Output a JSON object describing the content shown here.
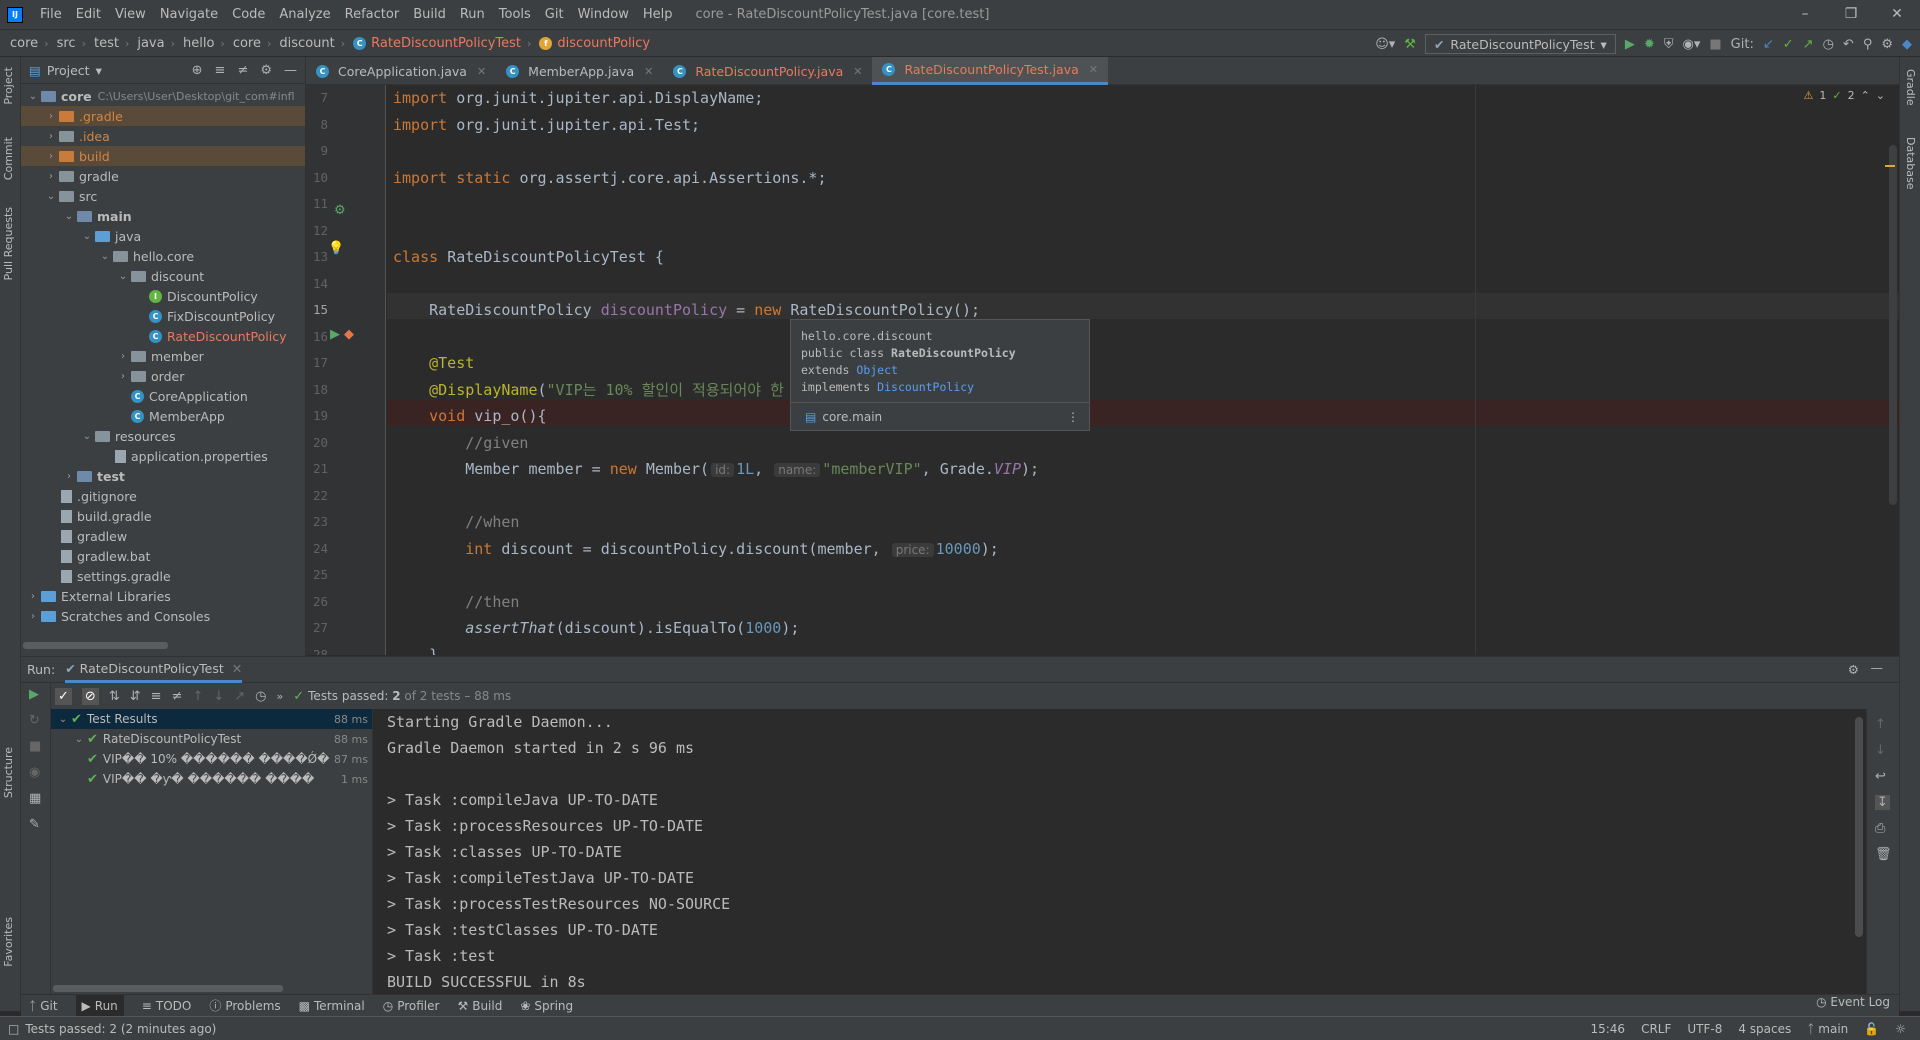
{
  "menu": {
    "items": [
      "File",
      "Edit",
      "View",
      "Navigate",
      "Code",
      "Analyze",
      "Refactor",
      "Build",
      "Run",
      "Tools",
      "Git",
      "Window",
      "Help"
    ],
    "title": "core - RateDiscountPolicyTest.java [core.test]"
  },
  "breadcrumbs": [
    "core",
    "src",
    "test",
    "java",
    "hello",
    "core",
    "discount",
    "RateDiscountPolicyTest",
    "discountPolicy"
  ],
  "toolbar": {
    "run_config": "RateDiscountPolicyTest",
    "git_label": "Git:"
  },
  "project": {
    "title": "Project",
    "root_path": "C:\\Users\\User\\Desktop\\git_com#infl",
    "tree": [
      {
        "label": "core",
        "depth": 0,
        "arrow": "v",
        "type": "src",
        "bold": true
      },
      {
        "label": ".gradle",
        "depth": 1,
        "arrow": ">",
        "type": "orange",
        "color": "orange"
      },
      {
        "label": ".idea",
        "depth": 1,
        "arrow": ">",
        "type": "folder",
        "color": "orange"
      },
      {
        "label": "build",
        "depth": 1,
        "arrow": ">",
        "type": "orange",
        "color": "orange"
      },
      {
        "label": "gradle",
        "depth": 1,
        "arrow": ">",
        "type": "folder"
      },
      {
        "label": "src",
        "depth": 1,
        "arrow": "v",
        "type": "folder"
      },
      {
        "label": "main",
        "depth": 2,
        "arrow": "v",
        "type": "src",
        "bold": true
      },
      {
        "label": "java",
        "depth": 3,
        "arrow": "v",
        "type": "blue"
      },
      {
        "label": "hello.core",
        "depth": 4,
        "arrow": "v",
        "type": "folder"
      },
      {
        "label": "discount",
        "depth": 5,
        "arrow": "v",
        "type": "folder"
      },
      {
        "label": "DiscountPolicy",
        "depth": 6,
        "arrow": "",
        "type": "interface"
      },
      {
        "label": "FixDiscountPolicy",
        "depth": 6,
        "arrow": "",
        "type": "class"
      },
      {
        "label": "RateDiscountPolicy",
        "depth": 6,
        "arrow": "",
        "type": "class",
        "color": "red"
      },
      {
        "label": "member",
        "depth": 5,
        "arrow": ">",
        "type": "folder"
      },
      {
        "label": "order",
        "depth": 5,
        "arrow": ">",
        "type": "folder"
      },
      {
        "label": "CoreApplication",
        "depth": 5,
        "arrow": "",
        "type": "class"
      },
      {
        "label": "MemberApp",
        "depth": 5,
        "arrow": "",
        "type": "class"
      },
      {
        "label": "resources",
        "depth": 3,
        "arrow": "v",
        "type": "folder"
      },
      {
        "label": "application.properties",
        "depth": 4,
        "arrow": "",
        "type": "file"
      },
      {
        "label": "test",
        "depth": 2,
        "arrow": ">",
        "type": "src",
        "bold": true
      },
      {
        "label": ".gitignore",
        "depth": 1,
        "arrow": "",
        "type": "file"
      },
      {
        "label": "build.gradle",
        "depth": 1,
        "arrow": "",
        "type": "file"
      },
      {
        "label": "gradlew",
        "depth": 1,
        "arrow": "",
        "type": "file"
      },
      {
        "label": "gradlew.bat",
        "depth": 1,
        "arrow": "",
        "type": "file"
      },
      {
        "label": "settings.gradle",
        "depth": 1,
        "arrow": "",
        "type": "file"
      },
      {
        "label": "External Libraries",
        "depth": 0,
        "arrow": ">",
        "type": "lib"
      },
      {
        "label": "Scratches and Consoles",
        "depth": 0,
        "arrow": ">",
        "type": "lib"
      }
    ]
  },
  "tabs": [
    {
      "label": "CoreApplication.java",
      "active": false,
      "modified": false
    },
    {
      "label": "MemberApp.java",
      "active": false,
      "modified": false
    },
    {
      "label": "RateDiscountPolicy.java",
      "active": false,
      "modified": true
    },
    {
      "label": "RateDiscountPolicyTest.java",
      "active": true,
      "modified": true
    }
  ],
  "editor": {
    "inspections": {
      "warnings": "1",
      "weak": "2"
    },
    "lines": [
      {
        "n": "7",
        "tokens": [
          [
            "kw",
            "import "
          ],
          [
            "",
            "org.junit.jupiter.api.DisplayName;"
          ]
        ]
      },
      {
        "n": "8",
        "tokens": [
          [
            "kw",
            "import "
          ],
          [
            "",
            "org.junit.jupiter.api.Test;"
          ]
        ]
      },
      {
        "n": "9",
        "tokens": []
      },
      {
        "n": "10",
        "tokens": [
          [
            "kw",
            "import static "
          ],
          [
            "",
            "org.assertj.core.api.Assertions.*;"
          ]
        ]
      },
      {
        "n": "11",
        "tokens": []
      },
      {
        "n": "12",
        "tokens": []
      },
      {
        "n": "13",
        "tokens": [
          [
            "kw",
            "class "
          ],
          [
            "",
            "RateDiscountPolicyTest {"
          ]
        ]
      },
      {
        "n": "14",
        "tokens": []
      },
      {
        "n": "15",
        "tokens": [
          [
            "",
            "    RateDiscountPolicy "
          ],
          [
            "fieldname",
            "discountPolicy"
          ],
          [
            "",
            " = "
          ],
          [
            "kw",
            "new "
          ],
          [
            "",
            "RateDiscountPolicy();"
          ]
        ]
      },
      {
        "n": "16",
        "tokens": []
      },
      {
        "n": "17",
        "tokens": [
          [
            "ann",
            "    @Test"
          ]
        ]
      },
      {
        "n": "18",
        "tokens": [
          [
            "ann",
            "    @DisplayName"
          ],
          [
            "",
            "("
          ],
          [
            "str",
            "\"VIP는 10% 할인이 적용되어야 한"
          ]
        ]
      },
      {
        "n": "19",
        "tokens": [
          [
            "kw",
            "    void "
          ],
          [
            "",
            "vip_o(){"
          ]
        ]
      },
      {
        "n": "20",
        "tokens": [
          [
            "cmt",
            "        //given"
          ]
        ]
      },
      {
        "n": "21",
        "tokens": [
          [
            "",
            "        Member member = "
          ],
          [
            "kw",
            "new "
          ],
          [
            "",
            "Member("
          ],
          [
            "hint",
            "id:"
          ],
          [
            "num",
            "1L"
          ],
          [
            "",
            ", "
          ],
          [
            "hint",
            "name:"
          ],
          [
            "str",
            "\"memberVIP\""
          ],
          [
            "",
            ", Grade."
          ],
          [
            "fieldname it",
            "VIP"
          ],
          [
            "",
            ");"
          ]
        ]
      },
      {
        "n": "22",
        "tokens": []
      },
      {
        "n": "23",
        "tokens": [
          [
            "cmt",
            "        //when"
          ]
        ]
      },
      {
        "n": "24",
        "tokens": [
          [
            "kw",
            "        int "
          ],
          [
            "",
            "discount = discountPolicy.discount(member, "
          ],
          [
            "hint",
            "price:"
          ],
          [
            "num",
            "10000"
          ],
          [
            "",
            ");"
          ]
        ]
      },
      {
        "n": "25",
        "tokens": []
      },
      {
        "n": "26",
        "tokens": [
          [
            "cmt",
            "        //then"
          ]
        ]
      },
      {
        "n": "27",
        "tokens": [
          [
            "it",
            "        assertThat"
          ],
          [
            "",
            "(discount).isEqualTo("
          ],
          [
            "num",
            "1000"
          ],
          [
            "",
            ");"
          ]
        ]
      },
      {
        "n": "28",
        "tokens": [
          [
            "",
            "    }"
          ]
        ]
      }
    ]
  },
  "popup": {
    "package": "hello.core.discount",
    "decl_prefix": "public class ",
    "decl_name": "RateDiscountPolicy",
    "extends_kw": "extends ",
    "extends_name": "Object",
    "implements_kw": "implements ",
    "implements_name": "DiscountPolicy",
    "module": "core.main"
  },
  "run": {
    "label": "Run:",
    "tab": "RateDiscountPolicyTest",
    "status_prefix": "Tests passed:",
    "status_count": "2",
    "status_suffix": "of 2 tests – 88 ms",
    "tree": [
      {
        "label": "Test Results",
        "time": "88 ms",
        "depth": 0,
        "sel": true
      },
      {
        "label": "RateDiscountPolicyTest",
        "time": "88 ms",
        "depth": 1
      },
      {
        "label": "VIP�� 10% ������ ����Ǿ�",
        "time": "87 ms",
        "depth": 2
      },
      {
        "label": "VIP�� �ƴ� ������ ����",
        "time": "1 ms",
        "depth": 2
      }
    ],
    "console": [
      "Starting Gradle Daemon...",
      "Gradle Daemon started in 2 s 96 ms",
      "",
      "> Task :compileJava UP-TO-DATE",
      "> Task :processResources UP-TO-DATE",
      "> Task :classes UP-TO-DATE",
      "> Task :compileTestJava UP-TO-DATE",
      "> Task :processTestResources NO-SOURCE",
      "> Task :testClasses UP-TO-DATE",
      "> Task :test",
      "BUILD SUCCESSFUL in 8s"
    ]
  },
  "bottom_tabs": [
    "Git",
    "Run",
    "TODO",
    "Problems",
    "Terminal",
    "Profiler",
    "Build",
    "Spring"
  ],
  "event_log": "Event Log",
  "left_vtabs": [
    "Project",
    "Commit",
    "Pull Requests",
    "Structure",
    "Favorites"
  ],
  "right_vtabs": [
    "Gradle",
    "Database"
  ],
  "status": {
    "message": "Tests passed: 2 (2 minutes ago)",
    "position": "15:46",
    "line_sep": "CRLF",
    "encoding": "UTF-8",
    "indent": "4 spaces",
    "branch": "main"
  }
}
